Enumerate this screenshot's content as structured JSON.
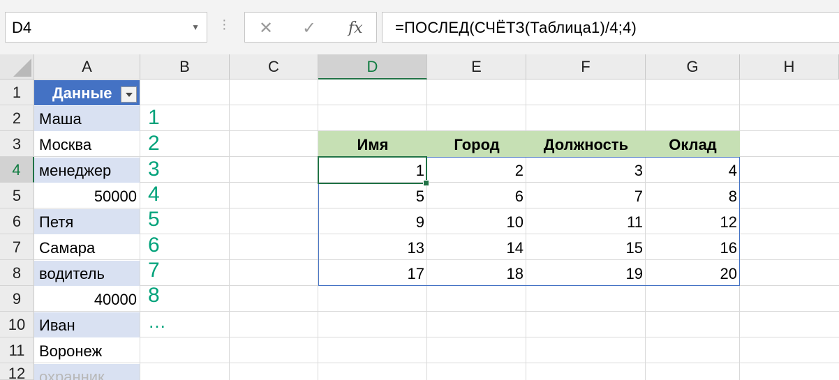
{
  "formula_bar": {
    "name_box": "D4",
    "formula": "=ПОСЛЕД(СЧЁТЗ(Таблица1)/4;4)",
    "cancel_icon": "✕",
    "enter_icon": "✓",
    "fx_icon": "fx"
  },
  "columns": [
    "A",
    "B",
    "C",
    "D",
    "E",
    "F",
    "G",
    "H"
  ],
  "rows": [
    "1",
    "2",
    "3",
    "4",
    "5",
    "6",
    "7",
    "8",
    "9",
    "10",
    "11",
    "12"
  ],
  "col_a": [
    "Данные",
    "Маша",
    "Москва",
    "менеджер",
    "50000",
    "Петя",
    "Самара",
    "водитель",
    "40000",
    "Иван",
    "Воронеж",
    "охранник"
  ],
  "col_b_numbers": [
    "1",
    "2",
    "3",
    "4",
    "5",
    "6",
    "7",
    "8",
    "…"
  ],
  "table": {
    "headers": [
      "Имя",
      "Город",
      "Должность",
      "Оклад"
    ],
    "rows": [
      [
        "1",
        "2",
        "3",
        "4"
      ],
      [
        "5",
        "6",
        "7",
        "8"
      ],
      [
        "9",
        "10",
        "11",
        "12"
      ],
      [
        "13",
        "14",
        "15",
        "16"
      ],
      [
        "17",
        "18",
        "19",
        "20"
      ]
    ]
  },
  "colors": {
    "accent": "#217346",
    "table_header_blue": "#4472c4",
    "band_blue": "#d9e1f2",
    "table_header_green": "#c6e0b4",
    "number_green": "#00a27a"
  }
}
